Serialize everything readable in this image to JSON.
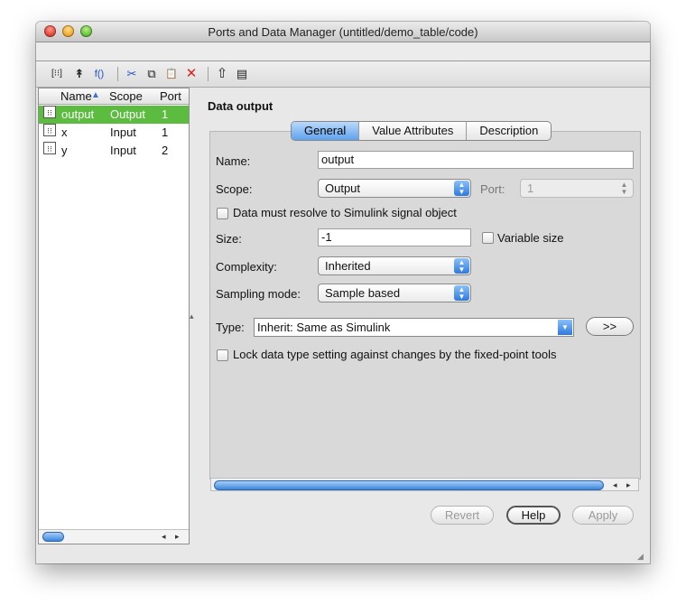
{
  "window": {
    "title": "Ports and Data Manager (untitled/demo_table/code)"
  },
  "toolbar": {
    "icons": [
      "add-data-icon",
      "add-event-icon",
      "add-function-icon",
      "cut-icon",
      "copy-icon",
      "paste-icon",
      "delete-icon",
      "move-up-icon",
      "properties-icon"
    ],
    "glyphs": {
      "add_data": "[⁝⁝]",
      "add_event": "↟",
      "add_function": "f()",
      "cut": "✂",
      "copy": "⧉",
      "paste": "📋",
      "delete": "✕",
      "up": "⇧",
      "props": "▤"
    }
  },
  "list": {
    "columns": [
      "Name",
      "Scope",
      "Port"
    ],
    "sort_indicator": "▲",
    "rows": [
      {
        "name": "output",
        "scope": "Output",
        "port": "1",
        "selected": true
      },
      {
        "name": "x",
        "scope": "Input",
        "port": "1",
        "selected": false
      },
      {
        "name": "y",
        "scope": "Input",
        "port": "2",
        "selected": false
      }
    ],
    "row_icon": "⁝⁝"
  },
  "detail": {
    "title": "Data output",
    "tabs": [
      "General",
      "Value Attributes",
      "Description"
    ],
    "active_tab": "General",
    "name_label": "Name:",
    "name_value": "output",
    "scope_label": "Scope:",
    "scope_value": "Output",
    "port_label": "Port:",
    "port_value": "1",
    "resolve_label": "Data must resolve to Simulink signal object",
    "size_label": "Size:",
    "size_value": "-1",
    "variable_size_label": "Variable size",
    "complexity_label": "Complexity:",
    "complexity_value": "Inherited",
    "sampling_label": "Sampling mode:",
    "sampling_value": "Sample based",
    "type_label": "Type:",
    "type_value": "Inherit: Same as Simulink",
    "expand_button": ">>",
    "lock_label": "Lock data type setting against changes by the fixed-point tools"
  },
  "buttons": {
    "revert": "Revert",
    "help": "Help",
    "apply": "Apply"
  },
  "colors": {
    "selection": "#5bbc40",
    "accent": "#3b86de"
  }
}
